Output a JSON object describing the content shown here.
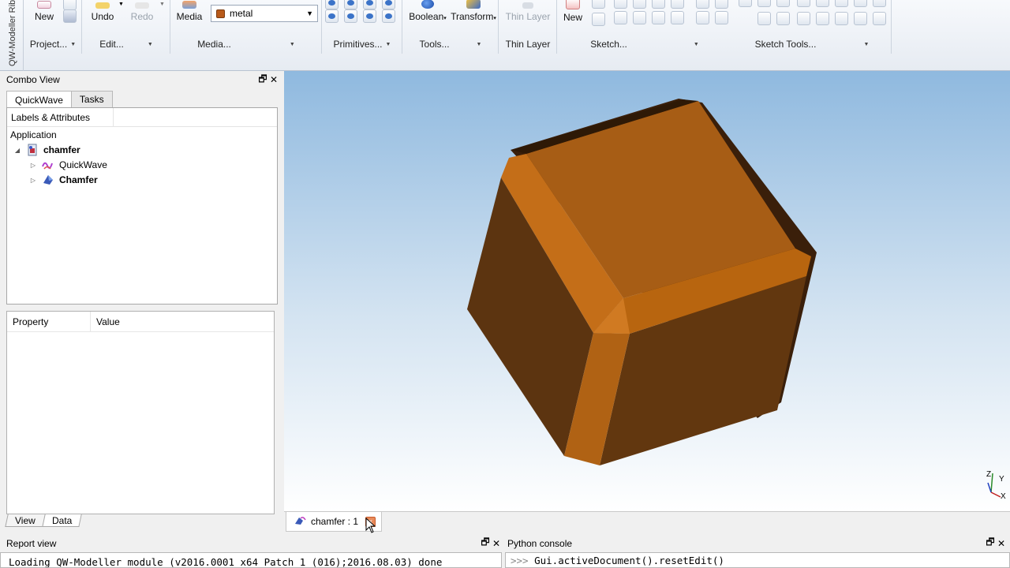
{
  "ribbon": {
    "vertical_title": "QW-Modeller Rib",
    "groups": {
      "project": {
        "label": "Project...",
        "new_label": "New"
      },
      "edit": {
        "label": "Edit...",
        "undo_label": "Undo",
        "redo_label": "Redo"
      },
      "media": {
        "label": "Media...",
        "media_label": "Media",
        "selected": "metal"
      },
      "primitives": {
        "label": "Primitives..."
      },
      "tools": {
        "label": "Tools...",
        "boolean_label": "Boolean",
        "transform_label": "Transform"
      },
      "thin_layer": {
        "label": "Thin Layer",
        "button_label": "Thin Layer"
      },
      "sketch": {
        "label": "Sketch...",
        "new_label": "New"
      },
      "sketch_tools": {
        "label": "Sketch Tools..."
      }
    }
  },
  "combo_view": {
    "title": "Combo View",
    "tabs": [
      "QuickWave",
      "Tasks"
    ],
    "tree": {
      "column": "Labels & Attributes",
      "root": "Application",
      "items": [
        {
          "label": "chamfer",
          "bold": true
        },
        {
          "label": "QuickWave",
          "bold": false
        },
        {
          "label": "Chamfer",
          "bold": true
        }
      ]
    },
    "properties": {
      "col_property": "Property",
      "col_value": "Value"
    },
    "bottom_tabs": [
      "View",
      "Data"
    ]
  },
  "document_tab": {
    "label": "chamfer : 1"
  },
  "axis": {
    "y_label": "Y",
    "x_label": "X",
    "z_label": "Z"
  },
  "report_view": {
    "title": "Report view",
    "text": "Loading QW-Modeller module (v2016.0001 x64 Patch 1 (016);2016.08.03) done"
  },
  "python_console": {
    "title": "Python console",
    "prompt": ">>>",
    "text": "Gui.activeDocument().resetEdit()"
  },
  "colors": {
    "object": "#a85a12",
    "viewport_top": "#8fb9df",
    "viewport_bottom": "#ffffff"
  }
}
